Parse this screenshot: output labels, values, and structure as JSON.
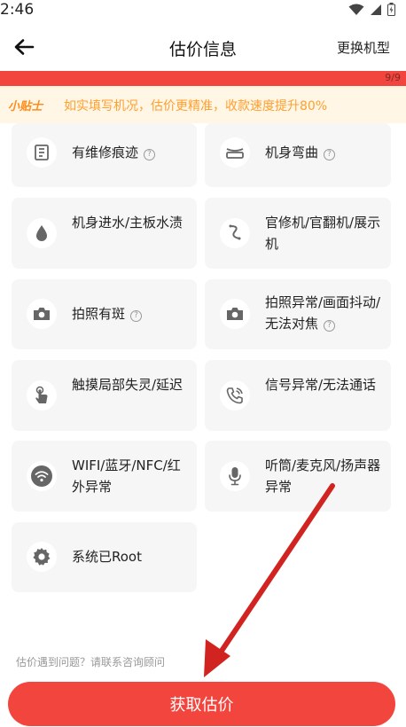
{
  "status_bar": {
    "time": "2:46",
    "icons": [
      "wifi-icon",
      "signal-icon",
      "battery-icon"
    ]
  },
  "header": {
    "title": "估价信息",
    "right_action": "更换机型",
    "back_icon": "back-arrow-icon"
  },
  "progress": {
    "text": "9/9",
    "fraction": 1.0,
    "color": "#f2453d"
  },
  "tip": {
    "label": "小贴士",
    "text": "如实填写机况，估价更精准，收款速度提升80%"
  },
  "options": [
    {
      "label": "有维修痕迹",
      "icon": "repair-icon",
      "help": "?"
    },
    {
      "label": "机身弯曲",
      "icon": "bent-body-icon",
      "help": "?"
    },
    {
      "label": "机身进水/主板水渍",
      "icon": "water-drop-icon"
    },
    {
      "label": "官修机/官翻机/展示机",
      "icon": "official-repair-icon"
    },
    {
      "label": "拍照有斑",
      "icon": "camera-icon",
      "help": "?"
    },
    {
      "label": "拍照异常/画面抖动/无法对焦",
      "icon": "camera-icon",
      "help": "?"
    },
    {
      "label": "触摸局部失灵/延迟",
      "icon": "touch-icon"
    },
    {
      "label": "信号异常/无法通话",
      "icon": "phone-icon"
    },
    {
      "label": "WIFI/蓝牙/NFC/红外异常",
      "icon": "wifi-icon"
    },
    {
      "label": "听筒/麦克风/扬声器异常",
      "icon": "microphone-icon"
    },
    {
      "label": "系统已Root",
      "icon": "gear-icon"
    }
  ],
  "bottom": {
    "hint": "估价遇到问题？请联系咨询顾问",
    "button": "获取估价"
  },
  "colors": {
    "accent": "#f2453d",
    "tip_text": "#ff9f2e",
    "card_bg": "#f6f6f6"
  }
}
